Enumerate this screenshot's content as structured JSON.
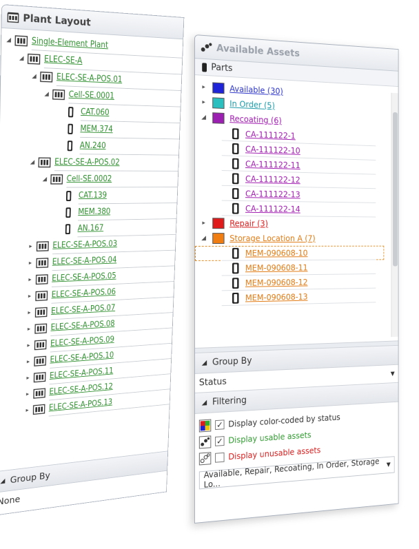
{
  "plant_layout": {
    "title": "Plant Layout",
    "icon": "plant-layout-icon",
    "tree": [
      {
        "label": "Single-Element Plant",
        "level": 0,
        "expanded": true
      },
      {
        "label": "ELEC-SE-A",
        "level": 1,
        "expanded": true
      },
      {
        "label": "ELEC-SE-A-POS.01",
        "level": 2,
        "expanded": true
      },
      {
        "label": "Cell-SE.0001",
        "level": 3,
        "expanded": true
      },
      {
        "label": "CAT.060",
        "level": 4
      },
      {
        "label": "MEM.374",
        "level": 4
      },
      {
        "label": "AN.240",
        "level": 4
      },
      {
        "label": "ELEC-SE-A-POS.02",
        "level": 2,
        "expanded": true
      },
      {
        "label": "Cell-SE.0002",
        "level": 3,
        "expanded": true
      },
      {
        "label": "CAT.139",
        "level": 4
      },
      {
        "label": "MEM.380",
        "level": 4
      },
      {
        "label": "AN.167",
        "level": 4
      },
      {
        "label": "ELEC-SE-A-POS.03",
        "level": 2,
        "expanded": false
      },
      {
        "label": "ELEC-SE-A-POS.04",
        "level": 2,
        "expanded": false
      },
      {
        "label": "ELEC-SE-A-POS.05",
        "level": 2,
        "expanded": false
      },
      {
        "label": "ELEC-SE-A-POS.06",
        "level": 2,
        "expanded": false
      },
      {
        "label": "ELEC-SE-A-POS.07",
        "level": 2,
        "expanded": false
      },
      {
        "label": "ELEC-SE-A-POS.08",
        "level": 2,
        "expanded": false
      },
      {
        "label": "ELEC-SE-A-POS.09",
        "level": 2,
        "expanded": false
      },
      {
        "label": "ELEC-SE-A-POS.10",
        "level": 2,
        "expanded": false
      },
      {
        "label": "ELEC-SE-A-POS.11",
        "level": 2,
        "expanded": false
      },
      {
        "label": "ELEC-SE-A-POS.12",
        "level": 2,
        "expanded": false
      },
      {
        "label": "ELEC-SE-A-POS.13",
        "level": 2,
        "expanded": false
      }
    ],
    "group_by_label": "Group By",
    "group_by_value": "None"
  },
  "available_assets": {
    "title": "Available Assets",
    "parts_label": "Parts",
    "groups": [
      {
        "label": "Available (30)",
        "color": "#1f24d8",
        "text_color": "#2b33c8",
        "expanded": false,
        "items": []
      },
      {
        "label": "In Order (5)",
        "color": "#2bbfbf",
        "text_color": "#1a9aa8",
        "expanded": false,
        "items": []
      },
      {
        "label": "Recoating (6)",
        "color": "#9b1fb0",
        "text_color": "#a01ab0",
        "expanded": true,
        "items": [
          "CA-111122-1",
          "CA-111122-10",
          "CA-111122-11",
          "CA-111122-12",
          "CA-111122-13",
          "CA-111122-14"
        ]
      },
      {
        "label": "Repair (3)",
        "color": "#e01b1b",
        "text_color": "#d81c1c",
        "expanded": false,
        "items": []
      },
      {
        "label": "Storage Location A (7)",
        "color": "#f07d12",
        "text_color": "#e07a12",
        "expanded": true,
        "items": [
          "MEM-090608-10",
          "MEM-090608-11",
          "MEM-090608-12",
          "MEM-090608-13"
        ]
      }
    ],
    "group_by": {
      "label": "Group By",
      "value": "Status"
    },
    "filtering": {
      "label": "Filtering",
      "options": [
        {
          "label": "Display color-coded by status",
          "checked": true,
          "color": "#333333",
          "icon": "palette-icon"
        },
        {
          "label": "Display usable assets",
          "checked": true,
          "color": "#2f9a2f",
          "icon": "assets-icon"
        },
        {
          "label": "Display unusable assets",
          "checked": false,
          "color": "#d81c1c",
          "icon": "assets-icon"
        }
      ],
      "status_filter": "Available, Repair, Recoating, In Order, Storage Lo..."
    }
  }
}
